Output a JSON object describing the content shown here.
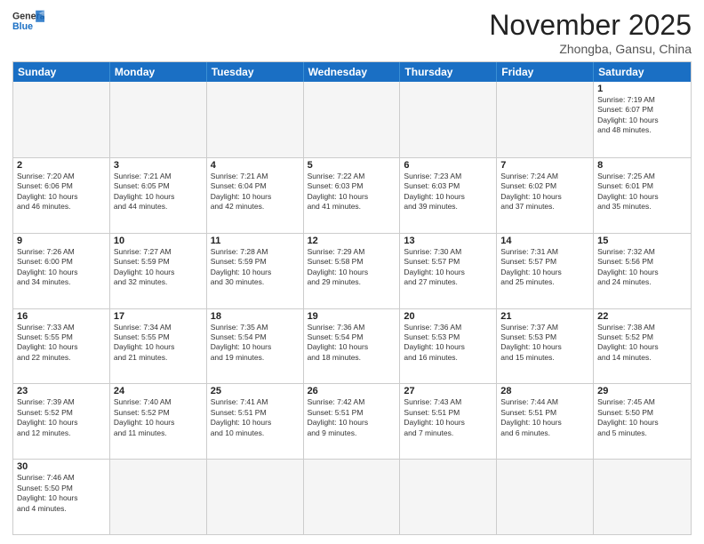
{
  "header": {
    "logo_general": "General",
    "logo_blue": "Blue",
    "month_title": "November 2025",
    "location": "Zhongba, Gansu, China"
  },
  "weekdays": [
    "Sunday",
    "Monday",
    "Tuesday",
    "Wednesday",
    "Thursday",
    "Friday",
    "Saturday"
  ],
  "rows": [
    [
      {
        "day": "",
        "info": "",
        "empty": true
      },
      {
        "day": "",
        "info": "",
        "empty": true
      },
      {
        "day": "",
        "info": "",
        "empty": true
      },
      {
        "day": "",
        "info": "",
        "empty": true
      },
      {
        "day": "",
        "info": "",
        "empty": true
      },
      {
        "day": "",
        "info": "",
        "empty": true
      },
      {
        "day": "1",
        "info": "Sunrise: 7:19 AM\nSunset: 6:07 PM\nDaylight: 10 hours\nand 48 minutes."
      }
    ],
    [
      {
        "day": "2",
        "info": "Sunrise: 7:20 AM\nSunset: 6:06 PM\nDaylight: 10 hours\nand 46 minutes."
      },
      {
        "day": "3",
        "info": "Sunrise: 7:21 AM\nSunset: 6:05 PM\nDaylight: 10 hours\nand 44 minutes."
      },
      {
        "day": "4",
        "info": "Sunrise: 7:21 AM\nSunset: 6:04 PM\nDaylight: 10 hours\nand 42 minutes."
      },
      {
        "day": "5",
        "info": "Sunrise: 7:22 AM\nSunset: 6:03 PM\nDaylight: 10 hours\nand 41 minutes."
      },
      {
        "day": "6",
        "info": "Sunrise: 7:23 AM\nSunset: 6:03 PM\nDaylight: 10 hours\nand 39 minutes."
      },
      {
        "day": "7",
        "info": "Sunrise: 7:24 AM\nSunset: 6:02 PM\nDaylight: 10 hours\nand 37 minutes."
      },
      {
        "day": "8",
        "info": "Sunrise: 7:25 AM\nSunset: 6:01 PM\nDaylight: 10 hours\nand 35 minutes."
      }
    ],
    [
      {
        "day": "9",
        "info": "Sunrise: 7:26 AM\nSunset: 6:00 PM\nDaylight: 10 hours\nand 34 minutes."
      },
      {
        "day": "10",
        "info": "Sunrise: 7:27 AM\nSunset: 5:59 PM\nDaylight: 10 hours\nand 32 minutes."
      },
      {
        "day": "11",
        "info": "Sunrise: 7:28 AM\nSunset: 5:59 PM\nDaylight: 10 hours\nand 30 minutes."
      },
      {
        "day": "12",
        "info": "Sunrise: 7:29 AM\nSunset: 5:58 PM\nDaylight: 10 hours\nand 29 minutes."
      },
      {
        "day": "13",
        "info": "Sunrise: 7:30 AM\nSunset: 5:57 PM\nDaylight: 10 hours\nand 27 minutes."
      },
      {
        "day": "14",
        "info": "Sunrise: 7:31 AM\nSunset: 5:57 PM\nDaylight: 10 hours\nand 25 minutes."
      },
      {
        "day": "15",
        "info": "Sunrise: 7:32 AM\nSunset: 5:56 PM\nDaylight: 10 hours\nand 24 minutes."
      }
    ],
    [
      {
        "day": "16",
        "info": "Sunrise: 7:33 AM\nSunset: 5:55 PM\nDaylight: 10 hours\nand 22 minutes."
      },
      {
        "day": "17",
        "info": "Sunrise: 7:34 AM\nSunset: 5:55 PM\nDaylight: 10 hours\nand 21 minutes."
      },
      {
        "day": "18",
        "info": "Sunrise: 7:35 AM\nSunset: 5:54 PM\nDaylight: 10 hours\nand 19 minutes."
      },
      {
        "day": "19",
        "info": "Sunrise: 7:36 AM\nSunset: 5:54 PM\nDaylight: 10 hours\nand 18 minutes."
      },
      {
        "day": "20",
        "info": "Sunrise: 7:36 AM\nSunset: 5:53 PM\nDaylight: 10 hours\nand 16 minutes."
      },
      {
        "day": "21",
        "info": "Sunrise: 7:37 AM\nSunset: 5:53 PM\nDaylight: 10 hours\nand 15 minutes."
      },
      {
        "day": "22",
        "info": "Sunrise: 7:38 AM\nSunset: 5:52 PM\nDaylight: 10 hours\nand 14 minutes."
      }
    ],
    [
      {
        "day": "23",
        "info": "Sunrise: 7:39 AM\nSunset: 5:52 PM\nDaylight: 10 hours\nand 12 minutes."
      },
      {
        "day": "24",
        "info": "Sunrise: 7:40 AM\nSunset: 5:52 PM\nDaylight: 10 hours\nand 11 minutes."
      },
      {
        "day": "25",
        "info": "Sunrise: 7:41 AM\nSunset: 5:51 PM\nDaylight: 10 hours\nand 10 minutes."
      },
      {
        "day": "26",
        "info": "Sunrise: 7:42 AM\nSunset: 5:51 PM\nDaylight: 10 hours\nand 9 minutes."
      },
      {
        "day": "27",
        "info": "Sunrise: 7:43 AM\nSunset: 5:51 PM\nDaylight: 10 hours\nand 7 minutes."
      },
      {
        "day": "28",
        "info": "Sunrise: 7:44 AM\nSunset: 5:51 PM\nDaylight: 10 hours\nand 6 minutes."
      },
      {
        "day": "29",
        "info": "Sunrise: 7:45 AM\nSunset: 5:50 PM\nDaylight: 10 hours\nand 5 minutes."
      }
    ],
    [
      {
        "day": "30",
        "info": "Sunrise: 7:46 AM\nSunset: 5:50 PM\nDaylight: 10 hours\nand 4 minutes."
      },
      {
        "day": "",
        "info": "",
        "empty": true
      },
      {
        "day": "",
        "info": "",
        "empty": true
      },
      {
        "day": "",
        "info": "",
        "empty": true
      },
      {
        "day": "",
        "info": "",
        "empty": true
      },
      {
        "day": "",
        "info": "",
        "empty": true
      },
      {
        "day": "",
        "info": "",
        "empty": true
      }
    ]
  ]
}
